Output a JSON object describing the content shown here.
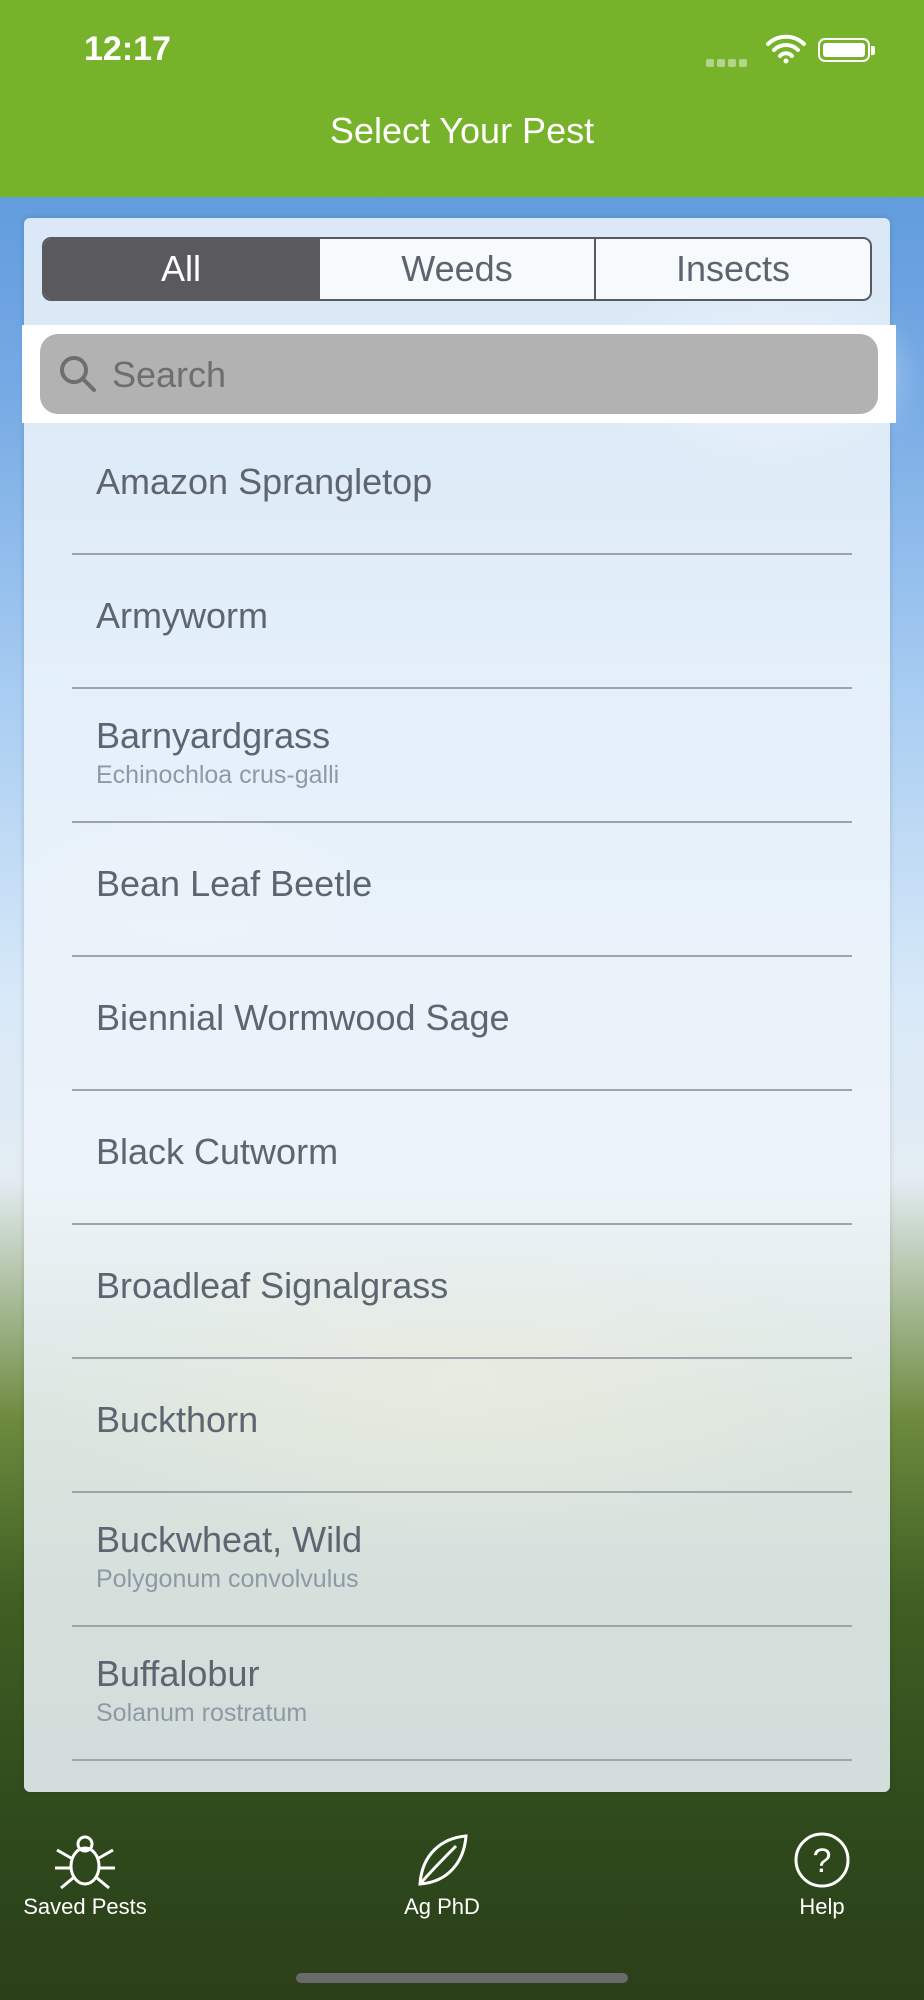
{
  "status_bar": {
    "time": "12:17"
  },
  "nav": {
    "title": "Select Your Pest"
  },
  "segments": [
    {
      "label": "All",
      "active": true
    },
    {
      "label": "Weeds",
      "active": false
    },
    {
      "label": "Insects",
      "active": false
    }
  ],
  "search": {
    "placeholder": "Search",
    "value": ""
  },
  "pests": [
    {
      "name": "Amazon Sprangletop",
      "scientific": ""
    },
    {
      "name": "Armyworm",
      "scientific": ""
    },
    {
      "name": "Barnyardgrass",
      "scientific": "Echinochloa crus-galli"
    },
    {
      "name": "Bean Leaf Beetle",
      "scientific": ""
    },
    {
      "name": "Biennial Wormwood Sage",
      "scientific": ""
    },
    {
      "name": "Black Cutworm",
      "scientific": ""
    },
    {
      "name": "Broadleaf Signalgrass",
      "scientific": ""
    },
    {
      "name": "Buckthorn",
      "scientific": ""
    },
    {
      "name": "Buckwheat, Wild",
      "scientific": "Polygonum convolvulus"
    },
    {
      "name": "Buffalobur",
      "scientific": "Solanum rostratum"
    }
  ],
  "tabbar": {
    "saved": "Saved Pests",
    "agphd": "Ag PhD",
    "help": "Help"
  },
  "colors": {
    "header_green": "#76b22a",
    "segment_active": "#5a5a5e",
    "search_fill": "#b2b2b2"
  },
  "icons": {
    "saved": "bug-icon",
    "agphd": "leaf-icon",
    "help": "help-circle-icon"
  }
}
